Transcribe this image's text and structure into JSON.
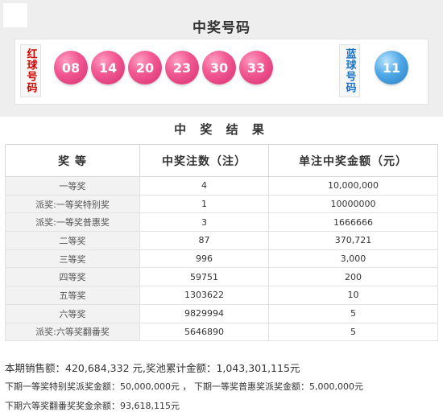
{
  "header": {
    "title": "中奖号码"
  },
  "red_label": "红球号码",
  "blue_label": "蓝球号码",
  "red_balls": [
    "08",
    "14",
    "20",
    "23",
    "30",
    "33"
  ],
  "blue_ball": "11",
  "results": {
    "title": "中 奖 结 果",
    "columns": [
      "奖 等",
      "中奖注数（注）",
      "单注中奖金额（元）"
    ],
    "rows": [
      [
        "一等奖",
        "4",
        "10,000,000"
      ],
      [
        "派奖:一等奖特别奖",
        "1",
        "10000000"
      ],
      [
        "派奖:一等奖普惠奖",
        "3",
        "1666666"
      ],
      [
        "二等奖",
        "87",
        "370,721"
      ],
      [
        "三等奖",
        "996",
        "3,000"
      ],
      [
        "四等奖",
        "59751",
        "200"
      ],
      [
        "五等奖",
        "1303622",
        "10"
      ],
      [
        "六等奖",
        "9829994",
        "5"
      ],
      [
        "派奖:六等奖翻番奖",
        "5646890",
        "5"
      ]
    ]
  },
  "footer": {
    "line1": "本期销售额：420,684,332 元,奖池累计金额：1,043,301,115元",
    "line2": "下期一等奖特别奖派奖金额：50,000,000元 ， 下期一等奖普惠奖派奖金额：5,000,000元",
    "line3": "下期六等奖翻番奖奖金余额：93,618,115元"
  }
}
